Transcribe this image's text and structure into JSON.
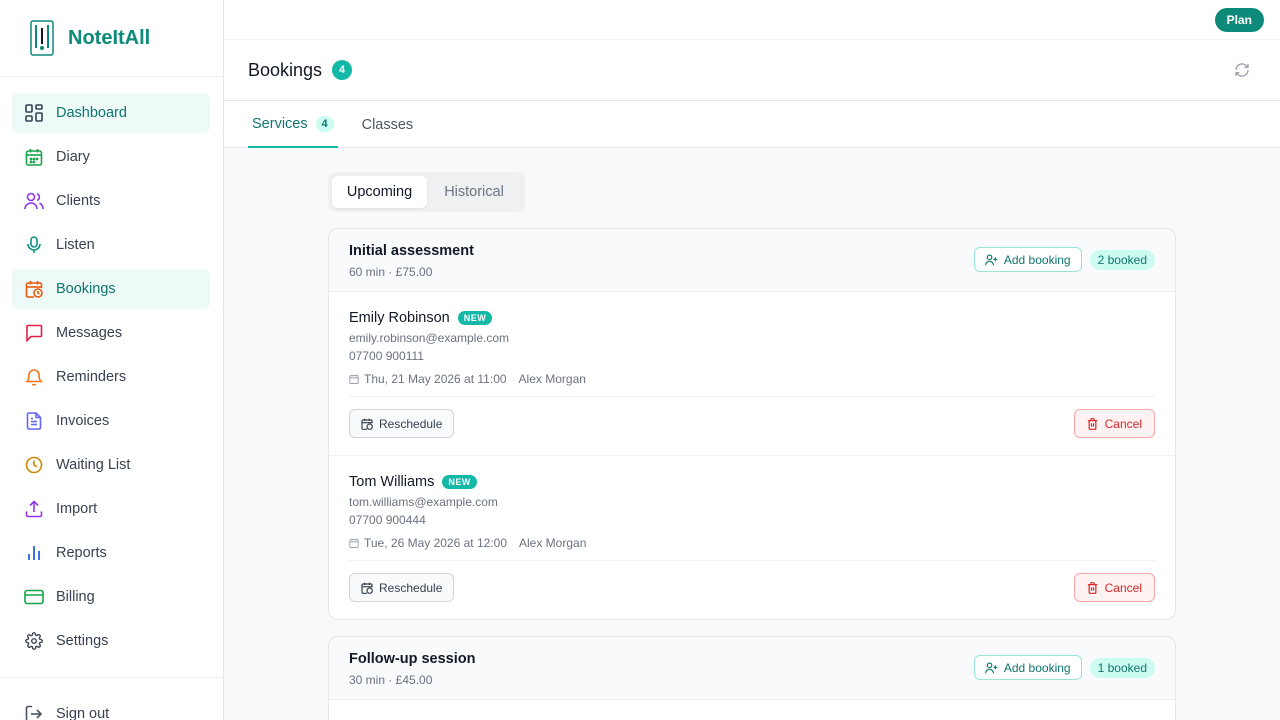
{
  "app": {
    "name": "NoteItAll",
    "plan_label": "Plan"
  },
  "sidebar": {
    "items": [
      {
        "label": "Dashboard",
        "icon": "dashboard-icon",
        "color": "#374151"
      },
      {
        "label": "Diary",
        "icon": "calendar-icon",
        "color": "#16a34a"
      },
      {
        "label": "Clients",
        "icon": "users-icon",
        "color": "#9333ea"
      },
      {
        "label": "Listen",
        "icon": "microphone-icon",
        "color": "#0d9488"
      },
      {
        "label": "Bookings",
        "icon": "calendar-clock-icon",
        "color": "#ea580c"
      },
      {
        "label": "Messages",
        "icon": "message-icon",
        "color": "#e11d48"
      },
      {
        "label": "Reminders",
        "icon": "bell-icon",
        "color": "#f97316"
      },
      {
        "label": "Invoices",
        "icon": "document-icon",
        "color": "#6366f1"
      },
      {
        "label": "Waiting List",
        "icon": "clock-icon",
        "color": "#ca8a04"
      },
      {
        "label": "Import",
        "icon": "upload-icon",
        "color": "#9333ea"
      },
      {
        "label": "Reports",
        "icon": "bar-chart-icon",
        "color": "#2563eb"
      },
      {
        "label": "Billing",
        "icon": "credit-card-icon",
        "color": "#16a34a"
      },
      {
        "label": "Settings",
        "icon": "gear-icon",
        "color": "#374151"
      }
    ],
    "signout_label": "Sign out"
  },
  "page": {
    "title": "Bookings",
    "count": "4"
  },
  "tabs": [
    {
      "label": "Services",
      "count": "4"
    },
    {
      "label": "Classes"
    }
  ],
  "segmented": {
    "upcoming": "Upcoming",
    "historical": "Historical"
  },
  "services": [
    {
      "name": "Initial assessment",
      "meta": "60 min · £75.00",
      "add_label": "Add booking",
      "booked_label": "2 booked",
      "bookings": [
        {
          "client": "Emily Robinson",
          "badge": "NEW",
          "email": "emily.robinson@example.com",
          "phone": "07700 900111",
          "when": "Thu, 21 May 2026 at 11:00",
          "practitioner": "Alex Morgan",
          "reschedule_label": "Reschedule",
          "cancel_label": "Cancel"
        },
        {
          "client": "Tom Williams",
          "badge": "NEW",
          "email": "tom.williams@example.com",
          "phone": "07700 900444",
          "when": "Tue, 26 May 2026 at 12:00",
          "practitioner": "Alex Morgan",
          "reschedule_label": "Reschedule",
          "cancel_label": "Cancel"
        }
      ]
    },
    {
      "name": "Follow-up session",
      "meta": "30 min · £45.00",
      "add_label": "Add booking",
      "booked_label": "1 booked"
    }
  ],
  "colors": {
    "brand": "#0d8a7a",
    "accent": "#14b8a6",
    "danger": "#dc2626"
  }
}
